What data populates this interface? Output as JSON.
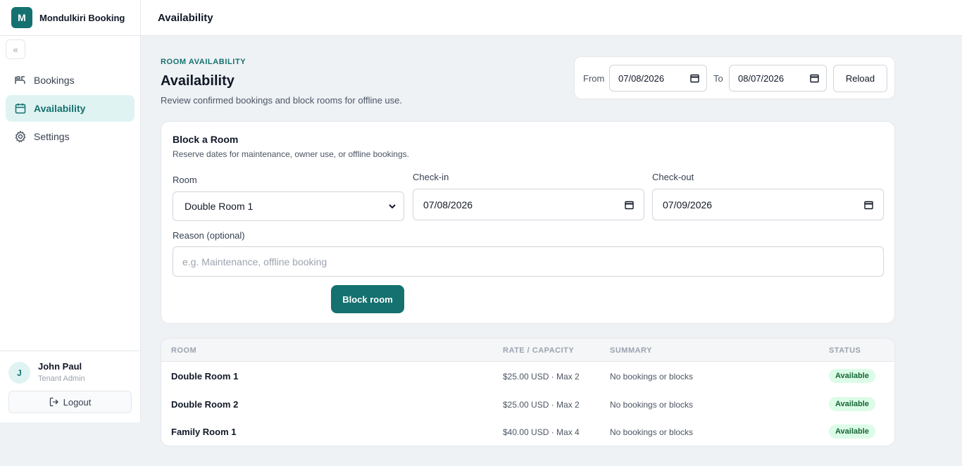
{
  "app": {
    "logo_letter": "M",
    "name": "Mondulkiri Booking"
  },
  "sidebar": {
    "collapse_icon": "«",
    "items": [
      {
        "label": "Bookings",
        "icon": "bookings-icon",
        "active": false
      },
      {
        "label": "Availability",
        "icon": "calendar-icon",
        "active": true
      },
      {
        "label": "Settings",
        "icon": "gear-icon",
        "active": false
      }
    ],
    "user": {
      "initial": "J",
      "name": "John Paul",
      "role": "Tenant Admin"
    },
    "logout_label": "Logout"
  },
  "topbar": {
    "title": "Availability"
  },
  "header": {
    "eyebrow": "ROOM AVAILABILITY",
    "title": "Availability",
    "description": "Review confirmed bookings and block rooms for offline use."
  },
  "range": {
    "from_label": "From",
    "from_value": "07/08/2026",
    "to_label": "To",
    "to_value": "08/07/2026",
    "reload_label": "Reload"
  },
  "block_form": {
    "title": "Block a Room",
    "subtitle": "Reserve dates for maintenance, owner use, or offline bookings.",
    "room_label": "Room",
    "room_value": "Double Room 1",
    "checkin_label": "Check-in",
    "checkin_value": "07/08/2026",
    "checkout_label": "Check-out",
    "checkout_value": "07/09/2026",
    "reason_label": "Reason (optional)",
    "reason_placeholder": "e.g. Maintenance, offline booking",
    "reason_value": "",
    "submit_label": "Block room"
  },
  "table": {
    "headers": {
      "room": "ROOM",
      "rate": "RATE / CAPACITY",
      "summary": "SUMMARY",
      "status": "STATUS"
    },
    "rows": [
      {
        "room": "Double Room 1",
        "rate": "$25.00 USD · Max 2",
        "summary": "No bookings or blocks",
        "status": "Available"
      },
      {
        "room": "Double Room 2",
        "rate": "$25.00 USD · Max 2",
        "summary": "No bookings or blocks",
        "status": "Available"
      },
      {
        "room": "Family Room 1",
        "rate": "$40.00 USD · Max 4",
        "summary": "No bookings or blocks",
        "status": "Available"
      }
    ]
  },
  "colors": {
    "accent": "#14716f",
    "accent_light": "#e0f3f3",
    "success_bg": "#dcfce7",
    "success_text": "#166534"
  }
}
